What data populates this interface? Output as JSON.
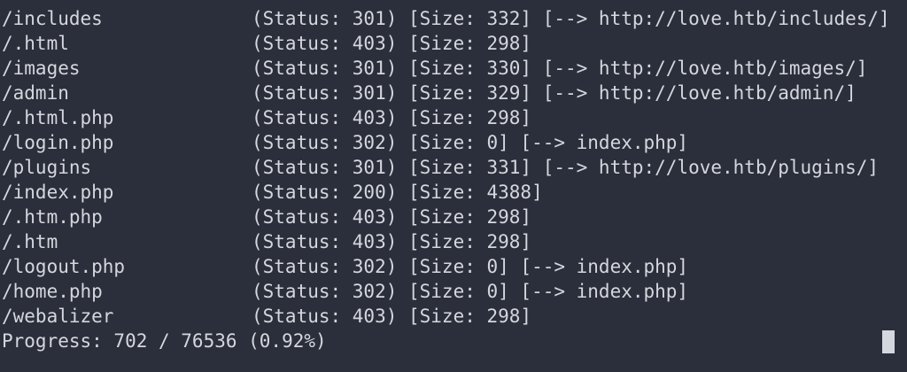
{
  "results": [
    {
      "path": "/includes",
      "info": "(Status: 301) [Size: 332] [--> http://love.htb/includes/]"
    },
    {
      "path": "/.html",
      "info": "(Status: 403) [Size: 298]"
    },
    {
      "path": "/images",
      "info": "(Status: 301) [Size: 330] [--> http://love.htb/images/]"
    },
    {
      "path": "/admin",
      "info": "(Status: 301) [Size: 329] [--> http://love.htb/admin/]"
    },
    {
      "path": "/.html.php",
      "info": "(Status: 403) [Size: 298]"
    },
    {
      "path": "/login.php",
      "info": "(Status: 302) [Size: 0] [--> index.php]"
    },
    {
      "path": "/plugins",
      "info": "(Status: 301) [Size: 331] [--> http://love.htb/plugins/]"
    },
    {
      "path": "/index.php",
      "info": "(Status: 200) [Size: 4388]"
    },
    {
      "path": "/.htm.php",
      "info": "(Status: 403) [Size: 298]"
    },
    {
      "path": "/.htm",
      "info": "(Status: 403) [Size: 298]"
    },
    {
      "path": "/logout.php",
      "info": "(Status: 302) [Size: 0] [--> index.php]"
    },
    {
      "path": "/home.php",
      "info": "(Status: 302) [Size: 0] [--> index.php]"
    },
    {
      "path": "/webalizer",
      "info": "(Status: 403) [Size: 298]"
    }
  ],
  "progress": "Progress: 702 / 76536 (0.92%)",
  "colors": {
    "background": "#2b2f3b",
    "foreground": "#d4d7dd"
  }
}
